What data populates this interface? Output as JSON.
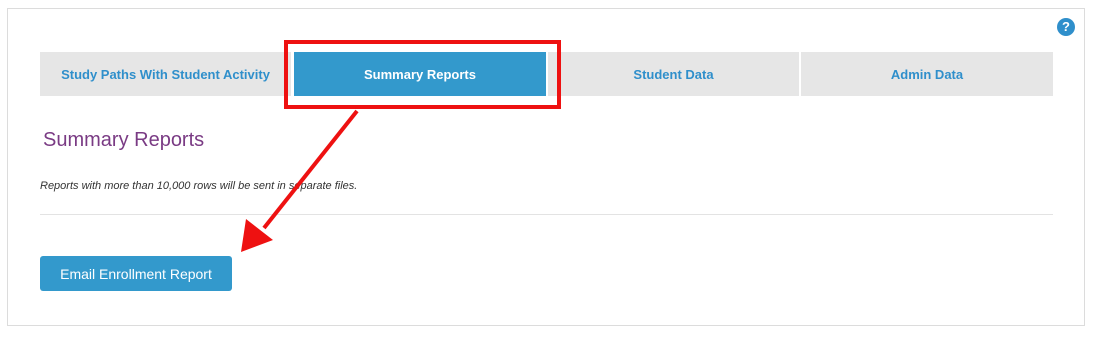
{
  "help": {
    "glyph": "?"
  },
  "tabs": [
    {
      "label": "Study Paths With Student Activity",
      "active": false
    },
    {
      "label": "Summary Reports",
      "active": true
    },
    {
      "label": "Student Data",
      "active": false
    },
    {
      "label": "Admin Data",
      "active": false
    }
  ],
  "main": {
    "title": "Summary Reports",
    "note": "Reports with more than 10,000 rows will be sent in separate files.",
    "email_button_label": "Email Enrollment Report"
  },
  "colors": {
    "accent": "#3399cc",
    "link": "#2f8fcb",
    "title": "#7a3b84",
    "tab_inactive_bg": "#e6e6e6",
    "annotation": "#ee1111"
  }
}
